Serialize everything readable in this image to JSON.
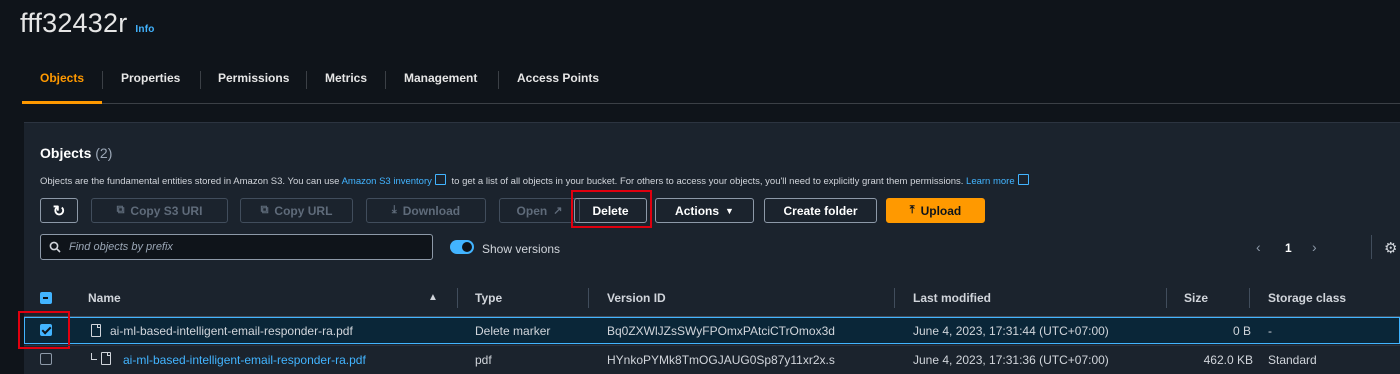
{
  "bucket": {
    "name": "fff32432r",
    "info_label": "Info"
  },
  "tabs": [
    {
      "label": "Objects",
      "active": true
    },
    {
      "label": "Properties"
    },
    {
      "label": "Permissions"
    },
    {
      "label": "Metrics"
    },
    {
      "label": "Management"
    },
    {
      "label": "Access Points"
    }
  ],
  "objects_panel": {
    "title": "Objects",
    "count": "(2)",
    "description_before": "Objects are the fundamental entities stored in Amazon S3. You can use",
    "inventory_link": "Amazon S3 inventory",
    "description_middle": "to get a list of all objects in your bucket. For others to access your objects, you'll need to explicitly grant them permissions.",
    "learn_more": "Learn more"
  },
  "toolbar": {
    "copy_s3_uri": "Copy S3 URI",
    "copy_url": "Copy URL",
    "download": "Download",
    "open": "Open",
    "delete": "Delete",
    "actions": "Actions",
    "create_folder": "Create folder",
    "upload": "Upload"
  },
  "search": {
    "placeholder": "Find objects by prefix",
    "value": ""
  },
  "show_versions": {
    "label": "Show versions",
    "enabled": true
  },
  "pagination": {
    "current_page": "1"
  },
  "table": {
    "columns": [
      "Name",
      "Type",
      "Version ID",
      "Last modified",
      "Size",
      "Storage class"
    ],
    "rows": [
      {
        "selected": true,
        "name": "ai-ml-based-intelligent-email-responder-ra.pdf",
        "type": "Delete marker",
        "version_id": "Bq0ZXWlJZsSWyFPOmxPAtciCTrOmox3d",
        "last_modified": "June 4, 2023, 17:31:44 (UTC+07:00)",
        "size": "0 B",
        "storage_class": "-"
      },
      {
        "selected": false,
        "name": "ai-ml-based-intelligent-email-responder-ra.pdf",
        "type": "pdf",
        "version_id": "HYnkoPYMk8TmOGJAUG0Sp87y11xr2x.s",
        "last_modified": "June 4, 2023, 17:31:36 (UTC+07:00)",
        "size": "462.0 KB",
        "storage_class": "Standard"
      }
    ]
  },
  "colors": {
    "accent": "#ff9900",
    "link": "#42b4ff",
    "highlight_box": "#e0000f",
    "background": "#0f141a",
    "panel": "#1b232d"
  }
}
